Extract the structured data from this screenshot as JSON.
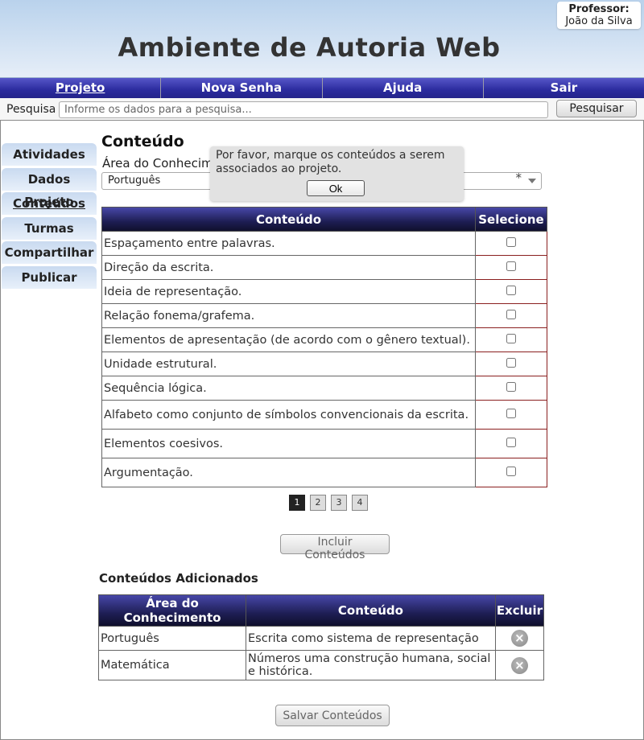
{
  "header": {
    "title": "Ambiente de Autoria Web",
    "professor_label": "Professor:",
    "professor_name": "João da Silva"
  },
  "nav": {
    "items": [
      {
        "label": "Projeto",
        "active": true
      },
      {
        "label": "Nova Senha"
      },
      {
        "label": "Ajuda"
      },
      {
        "label": "Sair"
      }
    ]
  },
  "search": {
    "label": "Pesquisa",
    "placeholder": "Informe os dados para a pesquisa...",
    "button_label": "Pesquisar"
  },
  "sidebar": {
    "items": [
      {
        "label": "Atividades"
      },
      {
        "label": "Dados Projeto"
      },
      {
        "label": "Conteúdos",
        "active": true
      },
      {
        "label": "Turmas"
      },
      {
        "label": "Compartilhar"
      },
      {
        "label": "Publicar"
      }
    ]
  },
  "main": {
    "title": "Conteúdo",
    "area_label": "Área do Conhecimento",
    "area_selected": "Português",
    "area_required_mark": "*",
    "popup": {
      "message": "Por favor, marque os conteúdos a serem associados ao projeto.",
      "ok_label": "Ok"
    },
    "table": {
      "headers": [
        "Conteúdo",
        "Selecione"
      ],
      "rows": [
        "Espaçamento entre palavras.",
        "Direção da escrita.",
        "Ideia de representação.",
        "Relação fonema/grafema.",
        "Elementos de apresentação (de acordo com o gênero textual).",
        "Unidade estrutural.",
        "Sequência lógica.",
        "Alfabeto como conjunto de símbolos convencionais da escrita.",
        "Elementos coesivos.",
        "Argumentação."
      ]
    },
    "pagination": {
      "pages": [
        "1",
        "2",
        "3",
        "4"
      ],
      "current": "1"
    },
    "include_button": "Incluir Conteúdos",
    "added": {
      "title": "Conteúdos Adicionados",
      "headers": [
        "Área do Conhecimento",
        "Conteúdo",
        "Excluir"
      ],
      "rows": [
        {
          "area": "Português",
          "conteudo": "Escrita como sistema de representação"
        },
        {
          "area": "Matemática",
          "conteudo": "Números uma construção humana, social e histórica."
        }
      ],
      "delete_icon": "remove-circle-icon"
    },
    "save_button": "Salvar Conteúdos"
  }
}
